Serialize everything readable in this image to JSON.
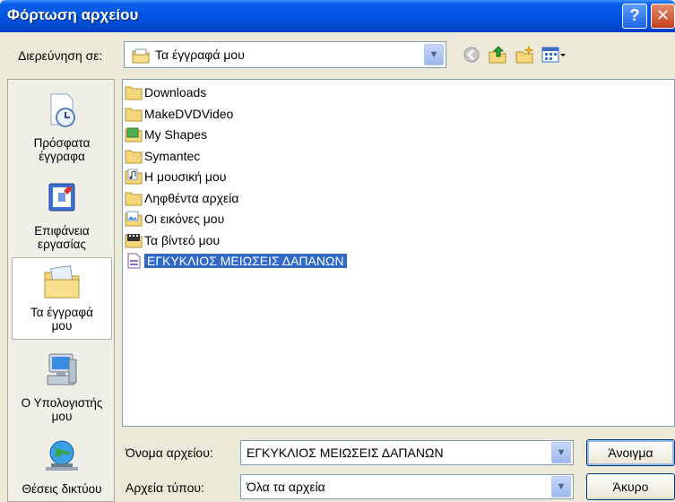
{
  "window": {
    "title": "Φόρτωση αρχείου",
    "help_label": "?",
    "close_label": "✕"
  },
  "lookin": {
    "label": "Διερεύνηση σε:",
    "value": "Τα έγγραφά μου"
  },
  "places": [
    {
      "label_line1": "Πρόσφατα",
      "label_line2": "έγγραφα",
      "icon": "recent-documents-icon"
    },
    {
      "label_line1": "Επιφάνεια",
      "label_line2": "εργασίας",
      "icon": "desktop-icon"
    },
    {
      "label_line1": "Τα έγγραφά",
      "label_line2": "μου",
      "icon": "my-documents-icon"
    },
    {
      "label_line1": "Ο Υπολογιστής",
      "label_line2": "μου",
      "icon": "my-computer-icon"
    },
    {
      "label_line1": "Θέσεις δικτύου",
      "label_line2": "",
      "icon": "network-places-icon"
    }
  ],
  "files": [
    {
      "name": "Downloads",
      "icon": "folder-icon"
    },
    {
      "name": "MakeDVDVideo",
      "icon": "folder-icon"
    },
    {
      "name": "My Shapes",
      "icon": "shapes-folder-icon"
    },
    {
      "name": "Symantec",
      "icon": "folder-icon"
    },
    {
      "name": "Η μουσική μου",
      "icon": "music-folder-icon"
    },
    {
      "name": "Ληφθέντα αρχεία",
      "icon": "folder-icon"
    },
    {
      "name": "Οι εικόνες μου",
      "icon": "pictures-folder-icon"
    },
    {
      "name": "Τα βίντεό μου",
      "icon": "videos-folder-icon"
    },
    {
      "name": "ΕΓΚΥΚΛΙΟΣ ΜΕΙΩΣΕΙΣ ΔΑΠΑΝΩΝ",
      "icon": "document-icon",
      "selected": true
    }
  ],
  "filename": {
    "label": "Όνομα αρχείου:",
    "value": "ΕΓΚΥΚΛΙΟΣ ΜΕΙΩΣΕΙΣ ΔΑΠΑΝΩΝ"
  },
  "filetype": {
    "label": "Αρχεία τύπου:",
    "value": "Όλα τα αρχεία"
  },
  "buttons": {
    "open": "Άνοιγμα",
    "cancel": "Άκυρο"
  },
  "colors": {
    "titlebar": "#0054e3",
    "selection": "#316ac5",
    "folder": "#f5d67a"
  }
}
